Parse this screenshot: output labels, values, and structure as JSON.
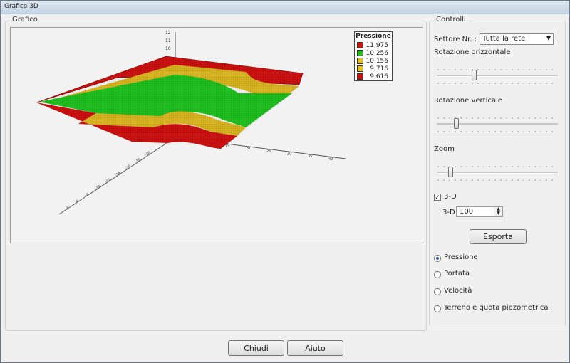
{
  "window": {
    "title": "Grafico 3D"
  },
  "grafico": {
    "legend": "Grafico",
    "axis_ticks": {
      "vertical": [
        "12",
        "11",
        "10"
      ],
      "right": [
        "5",
        "10",
        "15",
        "20",
        "25",
        "30",
        "35",
        "40"
      ],
      "left": [
        "-20",
        "-18",
        "-16",
        "-14",
        "-12",
        "-10",
        "-8",
        "-6",
        "-4"
      ]
    },
    "legend_box": {
      "title": "Pressione",
      "items": [
        {
          "value": "11,975",
          "color": "#cc1111"
        },
        {
          "value": "10,256",
          "color": "#22bb22"
        },
        {
          "value": "10,156",
          "color": "#ddbb22"
        },
        {
          "value": "9,716",
          "color": "#e8c21c"
        },
        {
          "value": "9,616",
          "color": "#cc1111"
        }
      ]
    }
  },
  "controlli": {
    "legend": "Controlli",
    "settore_label": "Settore Nr. :",
    "settore_value": "Tutta la rete",
    "rot_orizz_label": "Rotazione orizzontale",
    "rot_orizz_value": 0.3,
    "rot_vert_label": "Rotazione verticale",
    "rot_vert_value": 0.15,
    "zoom_label": "Zoom",
    "zoom_value": 0.1,
    "check_3d_label": "3-D",
    "check_3d_checked": true,
    "depth_label": "3-D",
    "depth_value": "100",
    "esporta_label": "Esporta",
    "radios": [
      {
        "label": "Pressione",
        "checked": true
      },
      {
        "label": "Portata",
        "checked": false
      },
      {
        "label": "Velocità",
        "checked": false
      },
      {
        "label": "Terreno e quota piezometrica",
        "checked": false
      }
    ]
  },
  "footer": {
    "chiudi_label": "Chiudi",
    "aiuto_label": "Aiuto"
  },
  "colors": {
    "red": "#cc1111",
    "yellow": "#d8b421",
    "green": "#1fbf1f"
  }
}
